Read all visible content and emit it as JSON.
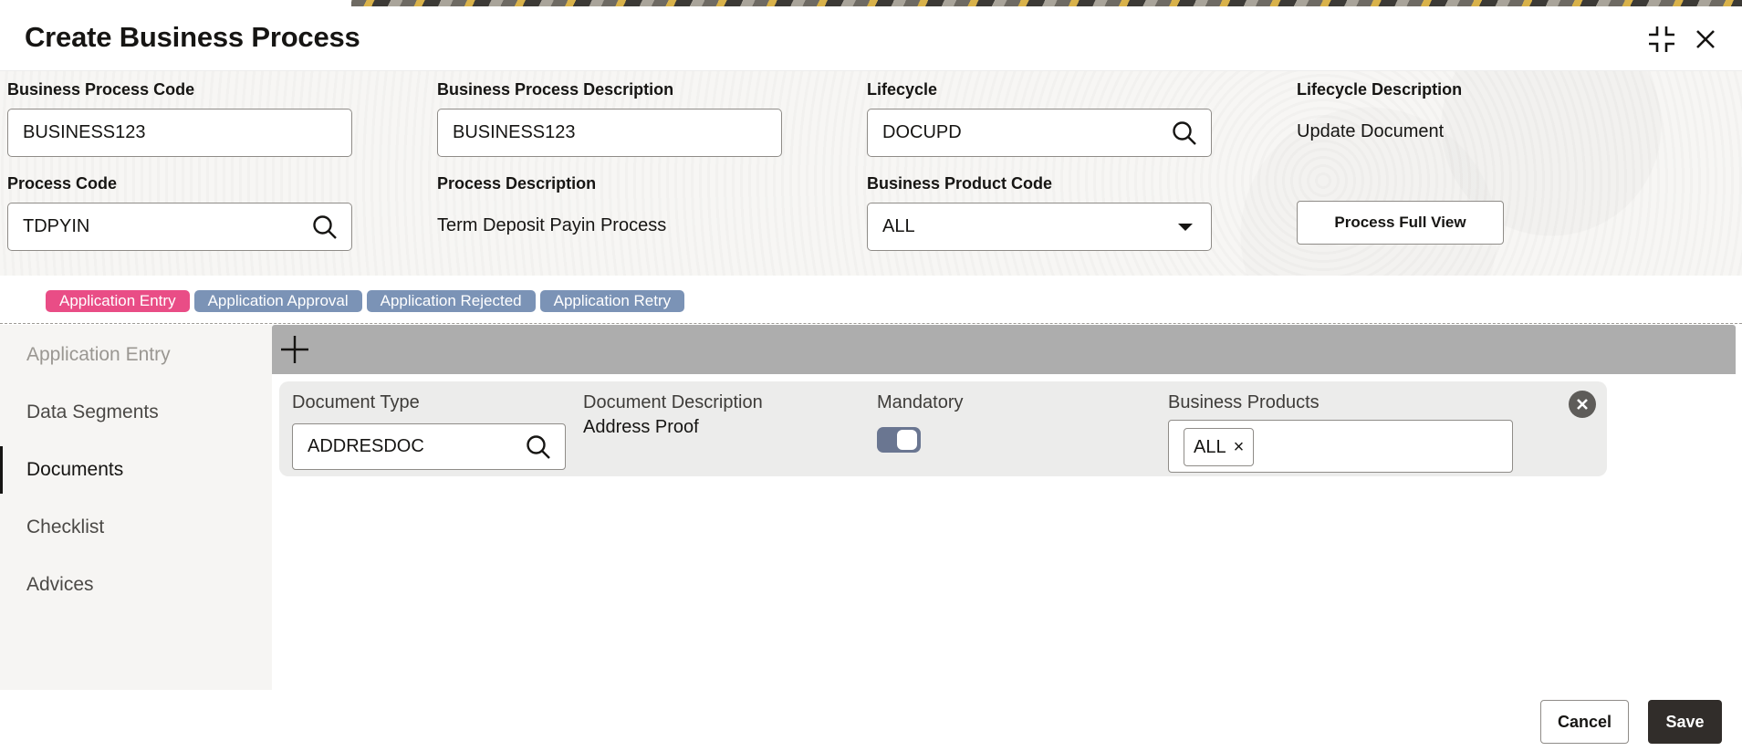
{
  "window": {
    "title": "Create Business Process",
    "compress_icon": "compress-icon",
    "close_icon": "close-icon"
  },
  "header": {
    "business_process_code": {
      "label": "Business Process Code",
      "value": "BUSINESS123"
    },
    "business_process_description": {
      "label": "Business Process Description",
      "value": "BUSINESS123"
    },
    "lifecycle": {
      "label": "Lifecycle",
      "value": "DOCUPD"
    },
    "lifecycle_description": {
      "label": "Lifecycle Description",
      "value": "Update Document"
    },
    "process_code": {
      "label": "Process Code",
      "value": "TDPYIN"
    },
    "process_description": {
      "label": "Process Description",
      "value": "Term Deposit Payin Process"
    },
    "business_product_code": {
      "label": "Business Product Code",
      "value": "ALL"
    },
    "process_full_view_label": "Process Full View"
  },
  "stages": [
    {
      "label": "Application Entry",
      "active": true
    },
    {
      "label": "Application Approval",
      "active": false
    },
    {
      "label": "Application Rejected",
      "active": false
    },
    {
      "label": "Application Retry",
      "active": false
    }
  ],
  "sidebar": {
    "items": [
      {
        "label": "Application Entry"
      },
      {
        "label": "Data Segments"
      },
      {
        "label": "Documents"
      },
      {
        "label": "Checklist"
      },
      {
        "label": "Advices"
      }
    ],
    "active_index": 2
  },
  "documents": {
    "add_icon": "plus-icon",
    "row": {
      "document_type_label": "Document Type",
      "document_type_value": "ADDRESDOC",
      "document_description_label": "Document Description",
      "document_description_value": "Address Proof",
      "mandatory_label": "Mandatory",
      "mandatory_on": true,
      "business_products_label": "Business Products",
      "business_products_chips": [
        "ALL"
      ],
      "chip_remove_glyph": "×"
    }
  },
  "footer": {
    "cancel_label": "Cancel",
    "save_label": "Save"
  },
  "colors": {
    "stage_active": "#e94d86",
    "stage_inactive": "#7b93b6",
    "toggle_on": "#6a7691",
    "save_button": "#312d2a",
    "toolbar": "#adadad"
  }
}
